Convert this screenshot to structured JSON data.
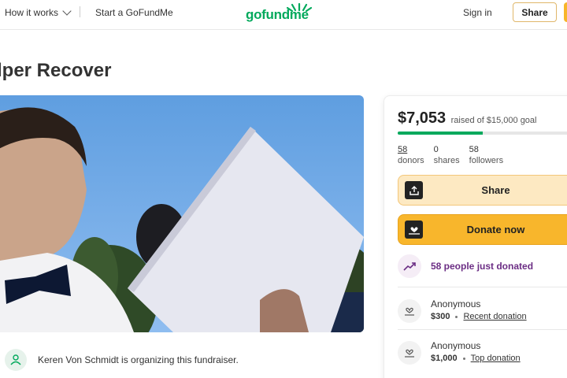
{
  "header": {
    "how_it_works": "How it works",
    "start": "Start a GoFundMe",
    "logo": "gofundme",
    "sign_in": "Sign in",
    "share": "Share"
  },
  "campaign": {
    "title_visible": "lper Recover",
    "organizer_text": "Keren Von Schmidt is organizing this fundraiser."
  },
  "progress": {
    "raised": "$7,053",
    "goal": "raised of $15,000 goal",
    "fraction": 0.47
  },
  "stats": [
    {
      "num": "58",
      "label": "donors"
    },
    {
      "num": "0",
      "label": "shares"
    },
    {
      "num": "58",
      "label": "followers"
    }
  ],
  "actions": {
    "share": "Share",
    "donate": "Donate now"
  },
  "trend_text": "58 people just donated",
  "donations": [
    {
      "name": "Anonymous",
      "amount": "$300",
      "tag": "Recent donation"
    },
    {
      "name": "Anonymous",
      "amount": "$1,000",
      "tag": "Top donation"
    }
  ],
  "colors": {
    "brand_green": "#02a95c",
    "donate_orange": "#f8b62c",
    "trend_purple": "#6b2d84"
  }
}
